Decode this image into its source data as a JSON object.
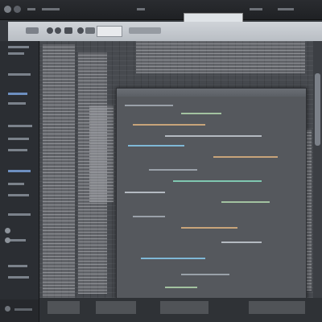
{
  "window": {
    "title": "",
    "accent_color": "#27b06a"
  },
  "toolbar": {
    "search_placeholder": ""
  },
  "icons": [
    "app-icon",
    "back-icon",
    "forward-icon",
    "play-icon",
    "record-icon",
    "settings-icon"
  ]
}
